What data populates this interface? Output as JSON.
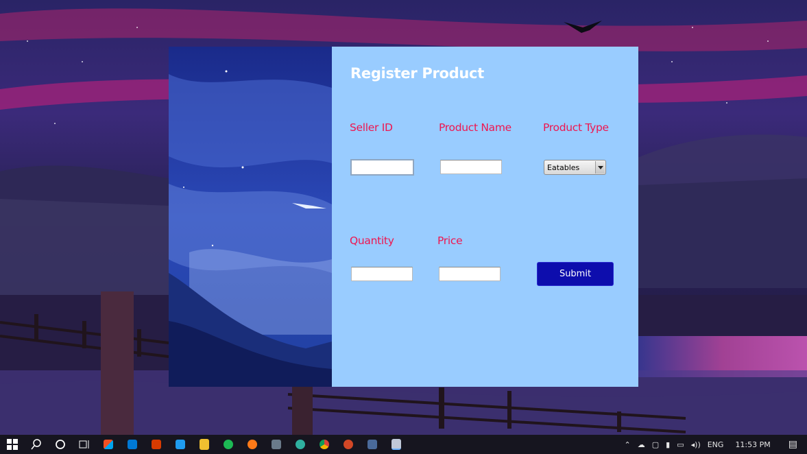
{
  "form": {
    "title": "Register Product",
    "labels": {
      "seller_id": "Seller ID",
      "product_name": "Product Name",
      "product_type": "Product Type",
      "quantity": "Quantity",
      "price": "Price"
    },
    "fields": {
      "seller_id": "",
      "product_name": "",
      "quantity": "",
      "price": ""
    },
    "product_type_selected": "Eatables",
    "submit_label": "Submit"
  },
  "taskbar": {
    "apps": [
      "start-icon",
      "search-icon",
      "cortana-icon",
      "task-view-icon",
      "store-icon",
      "mail-icon",
      "office-icon",
      "vscode-icon",
      "app-icon",
      "app-icon",
      "app-icon",
      "app-icon",
      "edge-icon",
      "chrome-icon",
      "powerpoint-icon",
      "app-icon",
      "java-app-icon"
    ],
    "language": "ENG",
    "time": "11:53 PM"
  },
  "colors": {
    "panel_bg": "#99ccff",
    "label_color": "#ee1650",
    "title_color": "#ffffff",
    "submit_bg": "#0d0dad",
    "taskbar_bg": "#16151f"
  }
}
